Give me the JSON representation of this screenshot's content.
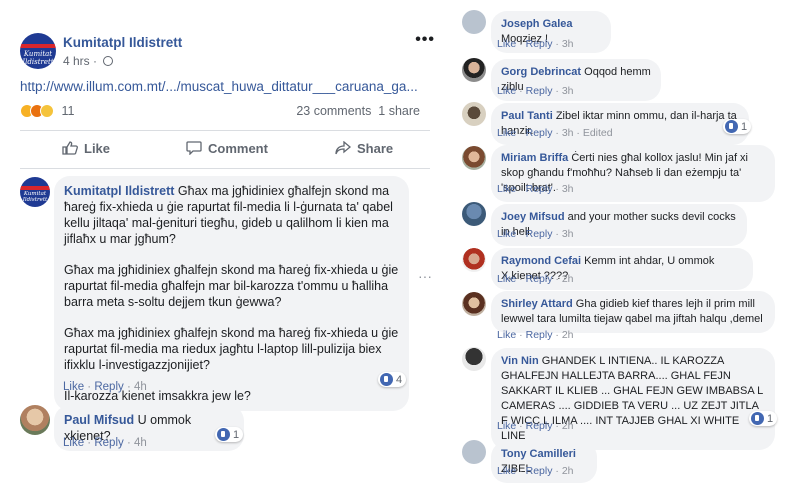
{
  "post": {
    "page_name": "Kumitatpl Ildistrett",
    "time": "4 hrs",
    "dot": "·",
    "link": "http://www.illum.com.mt/.../muscat_huwa_dittatur___caruana_ga...",
    "reaction_count": "11",
    "comments_count": "23 comments",
    "shares_count": "1 share",
    "actions": {
      "like": "Like",
      "comment": "Comment",
      "share": "Share"
    },
    "avatar_label": "Kumitat\nIldistrett"
  },
  "left_comments": [
    {
      "name": "Kumitatpl Ildistrett",
      "paragraphs": [
        "Għax ma jgħidiniex għalfejn skond ma ħareġ fix-xhieda u ġie rapurtat fil-media li l-ġurnata ta' qabel kellu jiltaqa' mal-ġenituri tiegħu, gideb u qalilhom li kien ma jiflaħx u mar jgħum?",
        "Għax ma jgħidiniex għalfejn skond ma ħareġ fix-xhieda u ġie rapurtat fil-media għalfejn mar bil-karozza t'ommu u ħalliha barra meta s-soltu dejjem tkun ġewwa?",
        "Għax ma jgħidiniex għalfejn skond ma ħareġ fix-xhieda u ġie rapurtat fil-media ma riedux jagħtu l-laptop lill-pulizija biex ifixklu l-investigazzjonijiet?",
        "Il-karozza kienet imsakkra jew le?"
      ],
      "like_label": "Like",
      "reply_label": "Reply",
      "time": "4h",
      "reactions": "4"
    },
    {
      "name": "Paul Mifsud",
      "text": "U ommok xkienet?",
      "like_label": "Like",
      "reply_label": "Reply",
      "time": "4h",
      "reactions": "1"
    }
  ],
  "right_comments": [
    {
      "name": "Joseph Galea",
      "text": "Moqziez !",
      "time": "3h",
      "extra": "",
      "reactions": ""
    },
    {
      "name": "Gorg Debrincat",
      "text": "Oqqod hemm ziblu",
      "time": "3h",
      "extra": "",
      "reactions": ""
    },
    {
      "name": "Paul Tanti",
      "text": "Zibel iktar minn ommu, dan il-harja ta hanzir.",
      "time": "3h",
      "extra": "Edited",
      "reactions": "1"
    },
    {
      "name": "Miriam Briffa",
      "text": "Ċerti nies għal kollox jaslu! Min jaf xi skop għandu f'moħħu? Naħseb li dan eżempju ta' 'spoilt brat'.",
      "time": "3h",
      "extra": "",
      "reactions": ""
    },
    {
      "name": "Joey Mifsud",
      "text": "and your mother sucks devil cocks in hell",
      "time": "3h",
      "extra": "",
      "reactions": ""
    },
    {
      "name": "Raymond Cefai",
      "text": "Kemm int ahdar, U ommok X,kienet ????",
      "time": "2h",
      "extra": "",
      "reactions": ""
    },
    {
      "name": "Shirley Attard",
      "text": "Gha gidieb kief thares lejh il prim mill lewwel tara lumilta tiejaw qabel ma jiftah halqu ,demel",
      "time": "2h",
      "extra": "",
      "reactions": ""
    },
    {
      "name": "Vin Nin",
      "text": "GHANDEK L INTIENA.. IL KAROZZA GHALFEJN HALLEJTA BARRA.... GHAL FEJN SAKKART IL KLIEB ... GHAL FEJN GEW IMBABSA L CAMERAS .... GIDDIEB TA VERU ... UZ ZEJT JITLA F WICC L ILMA .... INT TAJJEB GHAL XI WHITE LINE",
      "time": "2h",
      "extra": "",
      "reactions": "1"
    },
    {
      "name": "Tony Camilleri",
      "text": "ZIBEL",
      "time": "2h",
      "extra": "",
      "reactions": ""
    }
  ],
  "labels": {
    "like": "Like",
    "reply": "Reply",
    "sep": "·"
  },
  "icons": [
    "globe-icon",
    "more-options-icon",
    "like-icon",
    "comment-icon",
    "share-icon",
    "haha-reaction-icon",
    "angry-reaction-icon",
    "sad-reaction-icon",
    "like-reaction-icon",
    "comment-options-icon"
  ],
  "colors": {
    "link": "#365899",
    "meta": "#90949c",
    "bubble": "#f2f3f5",
    "like_blue": "#4267b2"
  }
}
